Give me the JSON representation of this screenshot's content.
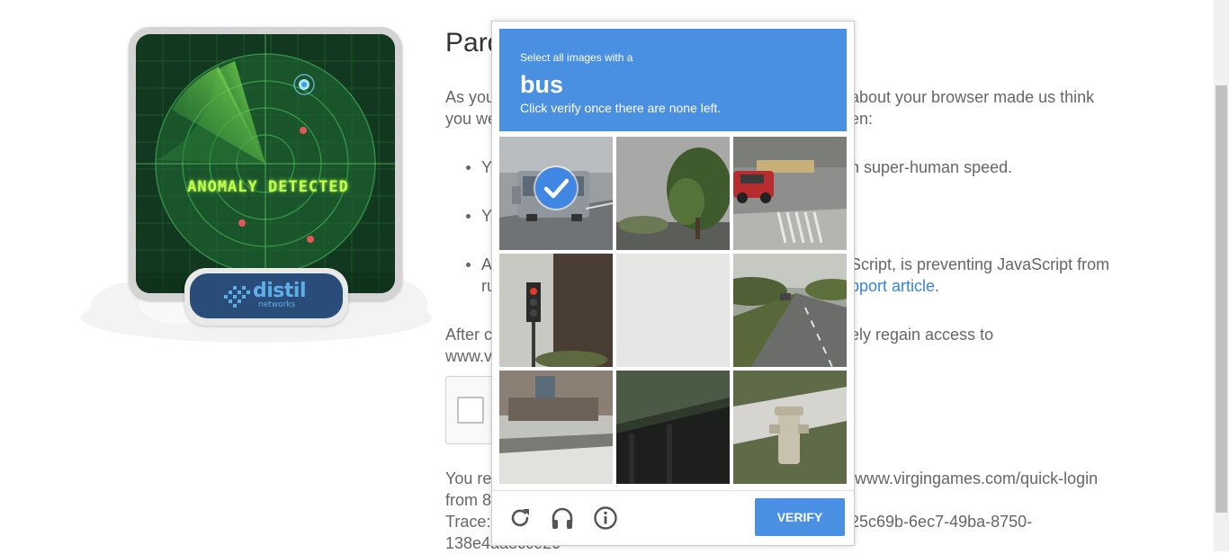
{
  "article": {
    "title": "Pard",
    "intro_line1_left": "As you",
    "intro_line1_right": "about your browser made us think",
    "intro_line2_left": "you we",
    "intro_line2_right": "en:",
    "bullet1_left": "Y",
    "bullet1_right": "h super-human speed.",
    "bullet2_left": "Y",
    "bullet3_left": "A",
    "bullet3_right": "Script, is preventing JavaScript from",
    "bullet3_line2_left": "ru",
    "bullet3_link": "pport article",
    "bullet3_period": ".",
    "after_left": "After c",
    "after_right": "ely regain access to",
    "after_line2": "www.v",
    "reached_left": "You re",
    "reached_right": "/www.virgingames.com/quick-login",
    "from_left": "from 8",
    "trace_left": "Trace:",
    "trace_right": "25c69b-6ec7-49ba-8750-",
    "trace_line2": "138e4aa8cce20"
  },
  "illustration": {
    "radar_text": "ANOMALY DETECTED",
    "brand_word": "distil",
    "brand_sub": "networks"
  },
  "captcha": {
    "instruction_line1": "Select all images with a",
    "target_word": "bus",
    "instruction_line3": "Click verify once there are none left.",
    "verify_label": "VERIFY",
    "selected_tiles": [
      0
    ],
    "icons": [
      "reload-icon",
      "audio-headphones-icon",
      "info-icon"
    ],
    "header_color": "#4a90e2"
  }
}
